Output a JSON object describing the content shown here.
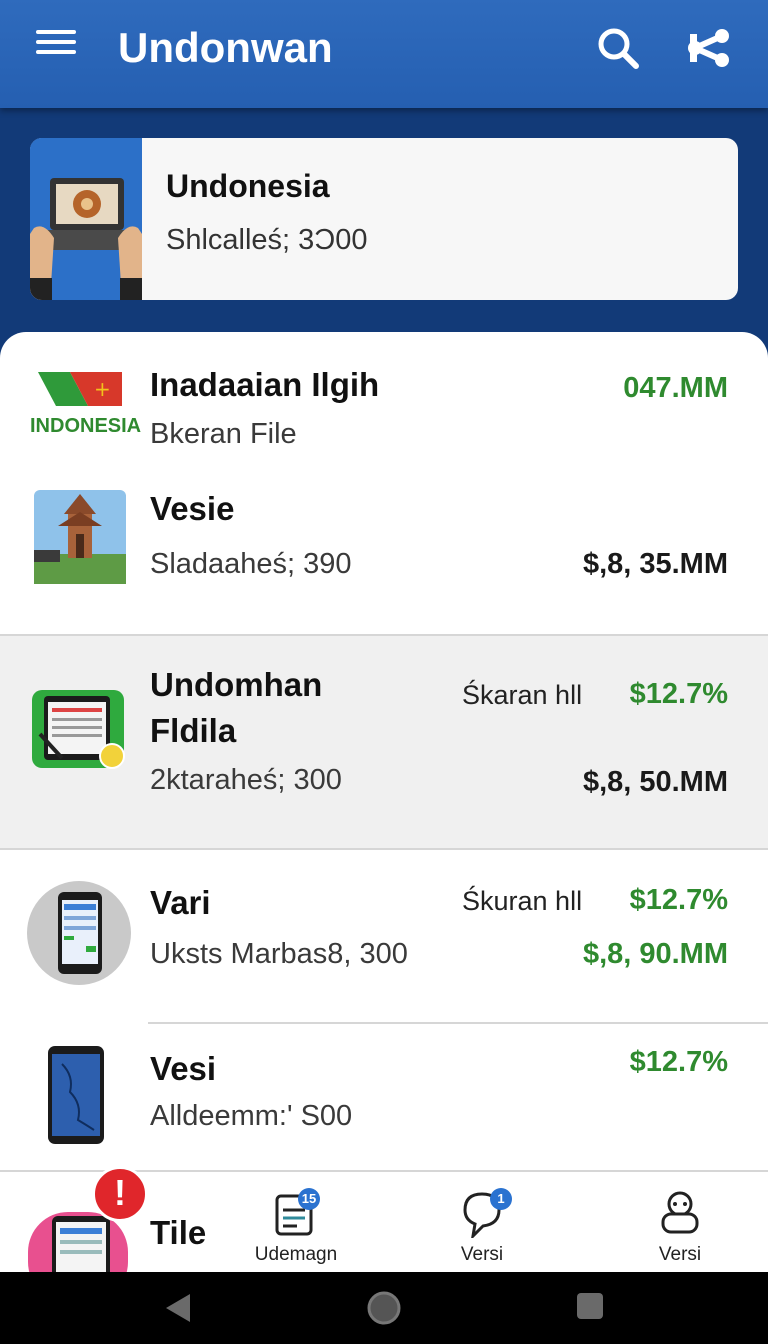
{
  "appbar": {
    "title": "Undonwan",
    "menu_icon": "hamburger-menu-icon",
    "search_icon": "search-icon",
    "share_icon": "share-icon"
  },
  "promo": {
    "title": "Undonesia",
    "subtitle": "Shlcalleś; 3Ͻ00",
    "image_icon": "laptop-hands-image"
  },
  "list": [
    {
      "logo_text": "INDONESIA",
      "title": "Inadaaian Ilgih",
      "subtitle": "Bkeran File",
      "value": "047.MM"
    },
    {
      "title": "Vesie",
      "subtitle": "Sladaaheś; 390",
      "value": "$,8, 35.MM"
    },
    {
      "title_line1": "Undomhan",
      "title_line2": "Fldila",
      "subtitle": "2ktaraheś; 300",
      "label": "Śkaran hll",
      "value_top": "$12.7%",
      "value_bottom": "$,8, 50.MM"
    },
    {
      "title": "Vari",
      "subtitle": "Uksts Marbas8, 300",
      "label": "Śkuran hll",
      "value_top": "$12.7%",
      "value_bottom": "$,8, 90.MM"
    },
    {
      "title": "Vesi",
      "subtitle": "Alldeemm:' S00",
      "value": "$12.7%"
    },
    {
      "title": "Tile"
    }
  ],
  "colors": {
    "appbar": "#2f6bbd",
    "background": "#123a78",
    "accent_green": "#2f8a2f",
    "alert": "#e0262b"
  },
  "bottom_nav": {
    "alert_text": "!",
    "items": [
      {
        "label": "Udemagn",
        "badge": "15"
      },
      {
        "label": "Versi",
        "badge": "1"
      },
      {
        "label": "Versi"
      }
    ]
  },
  "system_nav": [
    "back-icon",
    "home-icon",
    "recents-icon"
  ]
}
